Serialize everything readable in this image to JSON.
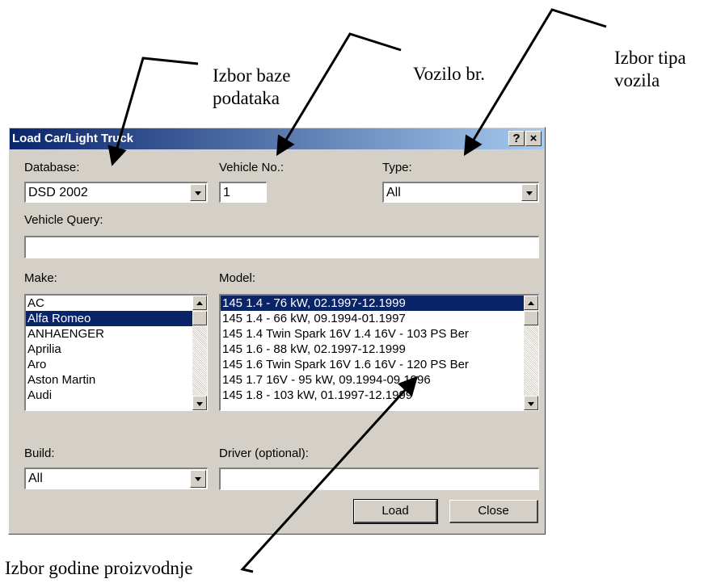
{
  "annotations": {
    "database": "Izbor baze\npodataka",
    "vehicle_no": "Vozilo br.",
    "vehicle_type": "Izbor tipa\nvozila",
    "build_year": "Izbor godine proizvodnje"
  },
  "dialog": {
    "title": "Load Car/Light Truck",
    "help_btn": "?",
    "close_btn": "×",
    "database": {
      "label": "Database:",
      "value": "DSD 2002"
    },
    "vehicle_no": {
      "label": "Vehicle No.:",
      "value": "1"
    },
    "type": {
      "label": "Type:",
      "value": "All"
    },
    "vehicle_query": {
      "label": "Vehicle Query:",
      "value": ""
    },
    "make": {
      "label": "Make:",
      "items": [
        "AC",
        "Alfa Romeo",
        "ANHAENGER",
        "Aprilia",
        "Aro",
        "Aston Martin",
        "Audi"
      ],
      "selected": "Alfa Romeo"
    },
    "model": {
      "label": "Model:",
      "items": [
        "145 1.4 - 76 kW, 02.1997-12.1999",
        "145 1.4 - 66 kW, 09.1994-01.1997",
        "145 1.4 Twin Spark 16V 1.4  16V  -  103 PS Ber",
        "145 1.6 - 88 kW, 02.1997-12.1999",
        "145 1.6 Twin Spark 16V 1.6  16V  -  120 PS Ber",
        "145 1.7 16V - 95 kW, 09.1994-09.1996",
        "145 1.8 - 103 kW, 01.1997-12.1999"
      ],
      "selected": "145 1.4 - 76 kW, 02.1997-12.1999"
    },
    "build": {
      "label": "Build:",
      "value": "All"
    },
    "driver": {
      "label": "Driver (optional):",
      "value": ""
    },
    "load_button": "Load",
    "close_button": "Close"
  },
  "colors": {
    "dialog_bg": "#d4d0c8",
    "title_active": "#0a246a",
    "selection": "#0a246a"
  }
}
